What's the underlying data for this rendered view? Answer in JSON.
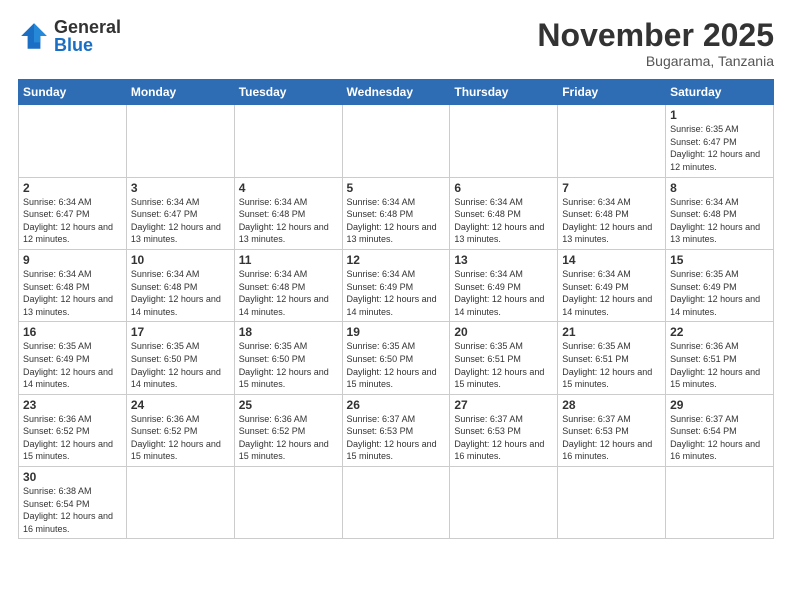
{
  "header": {
    "logo_general": "General",
    "logo_blue": "Blue",
    "month_title": "November 2025",
    "location": "Bugarama, Tanzania"
  },
  "weekdays": [
    "Sunday",
    "Monday",
    "Tuesday",
    "Wednesday",
    "Thursday",
    "Friday",
    "Saturday"
  ],
  "weeks": [
    [
      {
        "day": "",
        "info": "",
        "empty": true
      },
      {
        "day": "",
        "info": "",
        "empty": true
      },
      {
        "day": "",
        "info": "",
        "empty": true
      },
      {
        "day": "",
        "info": "",
        "empty": true
      },
      {
        "day": "",
        "info": "",
        "empty": true
      },
      {
        "day": "",
        "info": "",
        "empty": true
      },
      {
        "day": "1",
        "info": "Sunrise: 6:35 AM\nSunset: 6:47 PM\nDaylight: 12 hours\nand 12 minutes.",
        "empty": false
      }
    ],
    [
      {
        "day": "2",
        "info": "Sunrise: 6:34 AM\nSunset: 6:47 PM\nDaylight: 12 hours\nand 12 minutes.",
        "empty": false
      },
      {
        "day": "3",
        "info": "Sunrise: 6:34 AM\nSunset: 6:47 PM\nDaylight: 12 hours\nand 13 minutes.",
        "empty": false
      },
      {
        "day": "4",
        "info": "Sunrise: 6:34 AM\nSunset: 6:48 PM\nDaylight: 12 hours\nand 13 minutes.",
        "empty": false
      },
      {
        "day": "5",
        "info": "Sunrise: 6:34 AM\nSunset: 6:48 PM\nDaylight: 12 hours\nand 13 minutes.",
        "empty": false
      },
      {
        "day": "6",
        "info": "Sunrise: 6:34 AM\nSunset: 6:48 PM\nDaylight: 12 hours\nand 13 minutes.",
        "empty": false
      },
      {
        "day": "7",
        "info": "Sunrise: 6:34 AM\nSunset: 6:48 PM\nDaylight: 12 hours\nand 13 minutes.",
        "empty": false
      },
      {
        "day": "8",
        "info": "Sunrise: 6:34 AM\nSunset: 6:48 PM\nDaylight: 12 hours\nand 13 minutes.",
        "empty": false
      }
    ],
    [
      {
        "day": "9",
        "info": "Sunrise: 6:34 AM\nSunset: 6:48 PM\nDaylight: 12 hours\nand 13 minutes.",
        "empty": false
      },
      {
        "day": "10",
        "info": "Sunrise: 6:34 AM\nSunset: 6:48 PM\nDaylight: 12 hours\nand 14 minutes.",
        "empty": false
      },
      {
        "day": "11",
        "info": "Sunrise: 6:34 AM\nSunset: 6:48 PM\nDaylight: 12 hours\nand 14 minutes.",
        "empty": false
      },
      {
        "day": "12",
        "info": "Sunrise: 6:34 AM\nSunset: 6:49 PM\nDaylight: 12 hours\nand 14 minutes.",
        "empty": false
      },
      {
        "day": "13",
        "info": "Sunrise: 6:34 AM\nSunset: 6:49 PM\nDaylight: 12 hours\nand 14 minutes.",
        "empty": false
      },
      {
        "day": "14",
        "info": "Sunrise: 6:34 AM\nSunset: 6:49 PM\nDaylight: 12 hours\nand 14 minutes.",
        "empty": false
      },
      {
        "day": "15",
        "info": "Sunrise: 6:35 AM\nSunset: 6:49 PM\nDaylight: 12 hours\nand 14 minutes.",
        "empty": false
      }
    ],
    [
      {
        "day": "16",
        "info": "Sunrise: 6:35 AM\nSunset: 6:49 PM\nDaylight: 12 hours\nand 14 minutes.",
        "empty": false
      },
      {
        "day": "17",
        "info": "Sunrise: 6:35 AM\nSunset: 6:50 PM\nDaylight: 12 hours\nand 14 minutes.",
        "empty": false
      },
      {
        "day": "18",
        "info": "Sunrise: 6:35 AM\nSunset: 6:50 PM\nDaylight: 12 hours\nand 15 minutes.",
        "empty": false
      },
      {
        "day": "19",
        "info": "Sunrise: 6:35 AM\nSunset: 6:50 PM\nDaylight: 12 hours\nand 15 minutes.",
        "empty": false
      },
      {
        "day": "20",
        "info": "Sunrise: 6:35 AM\nSunset: 6:51 PM\nDaylight: 12 hours\nand 15 minutes.",
        "empty": false
      },
      {
        "day": "21",
        "info": "Sunrise: 6:35 AM\nSunset: 6:51 PM\nDaylight: 12 hours\nand 15 minutes.",
        "empty": false
      },
      {
        "day": "22",
        "info": "Sunrise: 6:36 AM\nSunset: 6:51 PM\nDaylight: 12 hours\nand 15 minutes.",
        "empty": false
      }
    ],
    [
      {
        "day": "23",
        "info": "Sunrise: 6:36 AM\nSunset: 6:52 PM\nDaylight: 12 hours\nand 15 minutes.",
        "empty": false
      },
      {
        "day": "24",
        "info": "Sunrise: 6:36 AM\nSunset: 6:52 PM\nDaylight: 12 hours\nand 15 minutes.",
        "empty": false
      },
      {
        "day": "25",
        "info": "Sunrise: 6:36 AM\nSunset: 6:52 PM\nDaylight: 12 hours\nand 15 minutes.",
        "empty": false
      },
      {
        "day": "26",
        "info": "Sunrise: 6:37 AM\nSunset: 6:53 PM\nDaylight: 12 hours\nand 15 minutes.",
        "empty": false
      },
      {
        "day": "27",
        "info": "Sunrise: 6:37 AM\nSunset: 6:53 PM\nDaylight: 12 hours\nand 16 minutes.",
        "empty": false
      },
      {
        "day": "28",
        "info": "Sunrise: 6:37 AM\nSunset: 6:53 PM\nDaylight: 12 hours\nand 16 minutes.",
        "empty": false
      },
      {
        "day": "29",
        "info": "Sunrise: 6:37 AM\nSunset: 6:54 PM\nDaylight: 12 hours\nand 16 minutes.",
        "empty": false
      }
    ],
    [
      {
        "day": "30",
        "info": "Sunrise: 6:38 AM\nSunset: 6:54 PM\nDaylight: 12 hours\nand 16 minutes.",
        "empty": false
      },
      {
        "day": "",
        "info": "",
        "empty": true
      },
      {
        "day": "",
        "info": "",
        "empty": true
      },
      {
        "day": "",
        "info": "",
        "empty": true
      },
      {
        "day": "",
        "info": "",
        "empty": true
      },
      {
        "day": "",
        "info": "",
        "empty": true
      },
      {
        "day": "",
        "info": "",
        "empty": true
      }
    ]
  ]
}
